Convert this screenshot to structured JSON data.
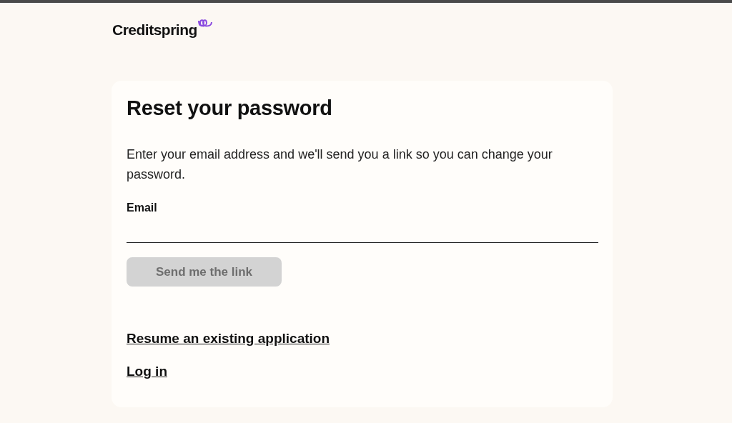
{
  "logo": {
    "text": "Creditspring"
  },
  "card": {
    "title": "Reset your password",
    "description": "Enter your email address and we'll send you a link so you can change your password.",
    "email_field": {
      "label": "Email"
    },
    "submit_button": {
      "label": "Send me the link",
      "disabled": true
    },
    "links": [
      "Resume an existing application",
      "Log in"
    ]
  }
}
